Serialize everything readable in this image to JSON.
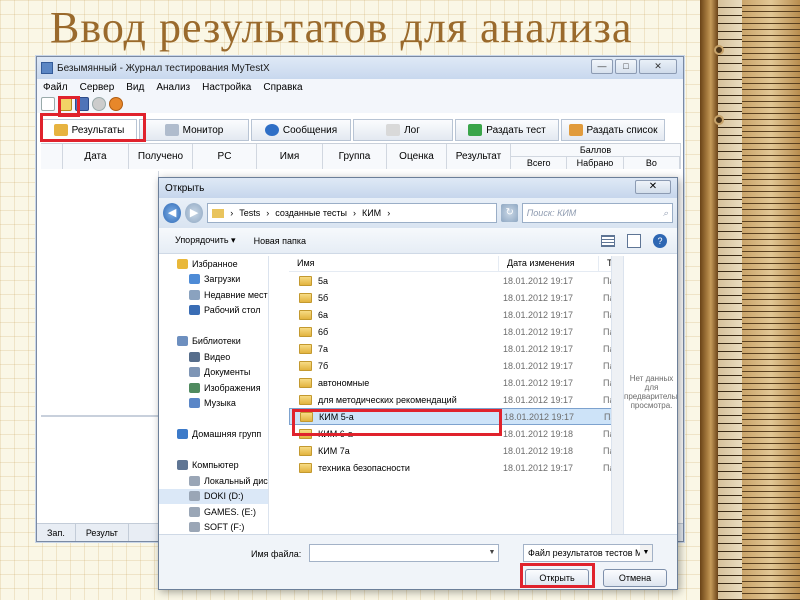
{
  "slide": {
    "title": "Ввод результатов для анализа"
  },
  "app": {
    "window_title": "Безымянный - Журнал тестирования MyTestX",
    "win_buttons": {
      "minimize": "—",
      "maximize": "□",
      "close": "✕"
    },
    "menu": [
      "Файл",
      "Сервер",
      "Вид",
      "Анализ",
      "Настройка",
      "Справка"
    ],
    "tabs": [
      {
        "label": "Результаты",
        "color": "#e7b340"
      },
      {
        "label": "Монитор",
        "color": "#b0bccd"
      },
      {
        "label": "Сообщения",
        "color": "#2f6fc6"
      },
      {
        "label": "Лог",
        "color": "#d9d9d9"
      },
      {
        "label": "Раздать тест",
        "color": "#3aa54a"
      },
      {
        "label": "Раздать список",
        "color": "#e19b3c"
      }
    ],
    "grid_headers": [
      "Дата",
      "Получено",
      "PC",
      "Имя",
      "Группа",
      "Оценка",
      "Результат"
    ],
    "balls": {
      "label": "Баллов",
      "sub": [
        "Всего",
        "Набрано",
        "Во"
      ]
    },
    "status": [
      "Зап.",
      "Результ"
    ]
  },
  "dialog": {
    "title": "Открыть",
    "close": "✕",
    "path": [
      "Tests",
      "созданные тесты",
      "КИМ"
    ],
    "search_placeholder": "Поиск: КИМ",
    "organize": "Упорядочить ▾",
    "new_folder": "Новая папка",
    "help": "?",
    "nav": [
      {
        "label": "Избранное",
        "color": "#e9b83a",
        "group": true
      },
      {
        "label": "Загрузки",
        "color": "#4e8bd6"
      },
      {
        "label": "Недавние мест",
        "color": "#8aa2bf"
      },
      {
        "label": "Рабочий стол",
        "color": "#3a6db5"
      },
      {
        "label": "",
        "color": "transparent"
      },
      {
        "label": "Библиотеки",
        "color": "#6d8fbf",
        "group": true
      },
      {
        "label": "Видео",
        "color": "#566d8b"
      },
      {
        "label": "Документы",
        "color": "#7e95b5"
      },
      {
        "label": "Изображения",
        "color": "#4f8a5f"
      },
      {
        "label": "Музыка",
        "color": "#5a86c7"
      },
      {
        "label": "",
        "color": "transparent"
      },
      {
        "label": "Домашняя групп",
        "color": "#3c7ac9",
        "group": true
      },
      {
        "label": "",
        "color": "transparent"
      },
      {
        "label": "Компьютер",
        "color": "#5f7594",
        "group": true
      },
      {
        "label": "Локальный дис",
        "color": "#9aa6b6"
      },
      {
        "label": "DOKI (D:)",
        "color": "#9aa6b6",
        "sel": true
      },
      {
        "label": "GAMES. (E:)",
        "color": "#9aa6b6"
      },
      {
        "label": "SOFT (F:)",
        "color": "#9aa6b6"
      }
    ],
    "columns": [
      "Имя",
      "Дата изменения",
      "Тип"
    ],
    "files": [
      {
        "name": "5а",
        "date": "18.01.2012 19:17",
        "type": "Па"
      },
      {
        "name": "5б",
        "date": "18.01.2012 19:17",
        "type": "Па"
      },
      {
        "name": "6а",
        "date": "18.01.2012 19:17",
        "type": "Па"
      },
      {
        "name": "6б",
        "date": "18.01.2012 19:17",
        "type": "Па"
      },
      {
        "name": "7а",
        "date": "18.01.2012 19:17",
        "type": "Па"
      },
      {
        "name": "7б",
        "date": "18.01.2012 19:17",
        "type": "Па"
      },
      {
        "name": "автономные",
        "date": "18.01.2012 19:17",
        "type": "Па"
      },
      {
        "name": "для методических рекомендаций",
        "date": "18.01.2012 19:17",
        "type": "Па"
      },
      {
        "name": "КИМ 5-а",
        "date": "18.01.2012 19:17",
        "type": "Па",
        "selected": true
      },
      {
        "name": "КИМ 6-а",
        "date": "18.01.2012 19:18",
        "type": "Па"
      },
      {
        "name": "КИМ 7а",
        "date": "18.01.2012 19:18",
        "type": "Па"
      },
      {
        "name": "техника безопасности",
        "date": "18.01.2012 19:17",
        "type": "Па"
      }
    ],
    "preview_text": "Нет данных для предварительного просмотра.",
    "filename_label": "Имя файла:",
    "filename_value": "",
    "filter": "Файл результатов тестов My",
    "open_button": "Открыть",
    "cancel_button": "Отмена"
  },
  "highlight_color": "#e0222c"
}
